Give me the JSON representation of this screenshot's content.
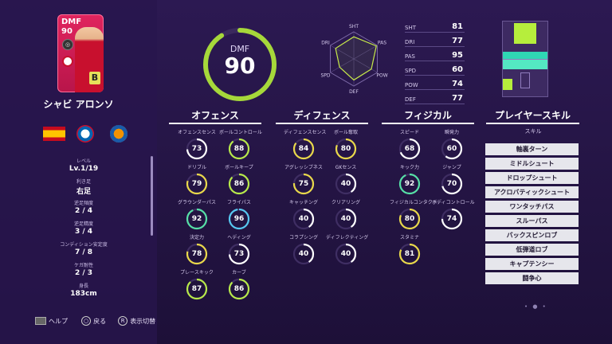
{
  "player": {
    "card_position": "DMF",
    "card_rating": "90",
    "card_playstyle": "B",
    "name": "シャビ アロンソ",
    "level_label": "レベル",
    "level": "Lv.1/19",
    "foot_label": "利き足",
    "foot": "右足",
    "weak_freq_label": "逆足頻度",
    "weak_freq": "2 / 4",
    "weak_acc_label": "逆足精度",
    "weak_acc": "3 / 4",
    "condition_label": "コンディション安定度",
    "condition": "7 / 8",
    "injury_label": "ケガ耐性",
    "injury": "2 / 3",
    "height_label": "身長",
    "height": "183cm"
  },
  "header": {
    "position": "DMF",
    "rating": "90"
  },
  "radar_labels": [
    "SHT",
    "PAS",
    "POW",
    "DEF",
    "SPD",
    "DRI"
  ],
  "stats": [
    {
      "key": "SHT",
      "value": "81"
    },
    {
      "key": "DRI",
      "value": "77"
    },
    {
      "key": "PAS",
      "value": "95"
    },
    {
      "key": "SPD",
      "value": "60"
    },
    {
      "key": "POW",
      "value": "74"
    },
    {
      "key": "DEF",
      "value": "77"
    }
  ],
  "categories": {
    "offense": {
      "title": "オフェンス",
      "items": [
        {
          "name": "オフェンスセンス",
          "value": "73",
          "color": "#ffffff"
        },
        {
          "name": "ボールコントロール",
          "value": "88",
          "color": "#b7e94a"
        },
        {
          "name": "ドリブル",
          "value": "79",
          "color": "#e9d84a"
        },
        {
          "name": "ボールキープ",
          "value": "86",
          "color": "#b7e94a"
        },
        {
          "name": "グラウンダーパス",
          "value": "92",
          "color": "#56e0a6"
        },
        {
          "name": "フライパス",
          "value": "96",
          "color": "#56c8f0"
        },
        {
          "name": "決定力",
          "value": "78",
          "color": "#e9d84a"
        },
        {
          "name": "ヘディング",
          "value": "73",
          "color": "#ffffff"
        },
        {
          "name": "プレースキック",
          "value": "87",
          "color": "#b7e94a"
        },
        {
          "name": "カーブ",
          "value": "86",
          "color": "#b7e94a"
        }
      ]
    },
    "defense": {
      "title": "ディフェンス",
      "items": [
        {
          "name": "ディフェンスセンス",
          "value": "84",
          "color": "#e9d84a"
        },
        {
          "name": "ボール奪取",
          "value": "80",
          "color": "#e9d84a"
        },
        {
          "name": "アグレッシブネス",
          "value": "75",
          "color": "#e9d84a"
        },
        {
          "name": "GKセンス",
          "value": "40",
          "color": "#ffffff"
        },
        {
          "name": "キャッチング",
          "value": "40",
          "color": "#ffffff"
        },
        {
          "name": "クリアリング",
          "value": "40",
          "color": "#ffffff"
        },
        {
          "name": "コラプシング",
          "value": "40",
          "color": "#ffffff"
        },
        {
          "name": "ディフレクティング",
          "value": "40",
          "color": "#ffffff"
        }
      ]
    },
    "physical": {
      "title": "フィジカル",
      "items": [
        {
          "name": "スピード",
          "value": "68",
          "color": "#ffffff"
        },
        {
          "name": "瞬発力",
          "value": "60",
          "color": "#ffffff"
        },
        {
          "name": "キック力",
          "value": "92",
          "color": "#56e0a6"
        },
        {
          "name": "ジャンプ",
          "value": "70",
          "color": "#ffffff"
        },
        {
          "name": "フィジカルコンタクト",
          "value": "80",
          "color": "#e9d84a"
        },
        {
          "name": "ボディコントロール",
          "value": "74",
          "color": "#ffffff"
        },
        {
          "name": "スタミナ",
          "value": "81",
          "color": "#e9d84a"
        }
      ]
    }
  },
  "skills": {
    "title": "プレイヤースキル",
    "header": "スキル",
    "items": [
      "軸裏ターン",
      "ミドルシュート",
      "ドロップシュート",
      "アクロバティックシュート",
      "ワンタッチパス",
      "スルーパス",
      "バックスピンロブ",
      "低弾道ロブ",
      "キャプテンシー",
      "闘争心"
    ]
  },
  "footer": {
    "help": "ヘルプ",
    "back_key": "○",
    "back": "戻る",
    "toggle_key": "R",
    "toggle": "表示切替"
  },
  "colors": {
    "accent": "#a6d83a",
    "bg": "#2c1952",
    "card": "#e0245e"
  }
}
